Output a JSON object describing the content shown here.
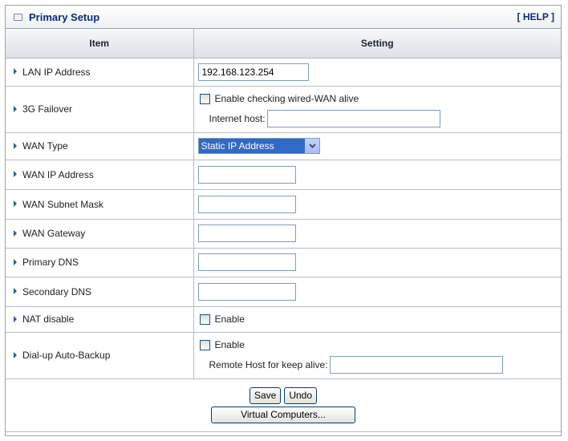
{
  "panel": {
    "title": "Primary Setup",
    "help": "[ HELP ]"
  },
  "table": {
    "item_header": "Item",
    "setting_header": "Setting"
  },
  "rows": {
    "lan_ip": {
      "label": "LAN IP Address",
      "value": "192.168.123.254"
    },
    "failover": {
      "label": "3G Failover",
      "check_label": "Enable checking wired-WAN alive",
      "checked": false,
      "host_label": "Internet host:",
      "host_value": ""
    },
    "wan_type": {
      "label": "WAN Type",
      "selected": "Static IP Address"
    },
    "wan_ip": {
      "label": "WAN IP Address",
      "value": ""
    },
    "wan_mask": {
      "label": "WAN Subnet Mask",
      "value": ""
    },
    "wan_gw": {
      "label": "WAN Gateway",
      "value": ""
    },
    "dns1": {
      "label": "Primary DNS",
      "value": ""
    },
    "dns2": {
      "label": "Secondary DNS",
      "value": ""
    },
    "nat": {
      "label": "NAT disable",
      "check_label": "Enable",
      "checked": false
    },
    "dialup": {
      "label": "Dial-up Auto-Backup",
      "check_label": "Enable",
      "checked": false,
      "host_label": "Remote Host for keep alive:",
      "host_value": ""
    }
  },
  "buttons": {
    "save": "Save",
    "undo": "Undo",
    "virtual": "Virtual Computers..."
  },
  "icons": {
    "panel": "window-icon",
    "bullet": "triangle-right-icon",
    "dropdown": "chevron-down-icon"
  },
  "colors": {
    "title": "#0c2a77",
    "select_highlight": "#3169c6",
    "button_border": "#003c74"
  }
}
